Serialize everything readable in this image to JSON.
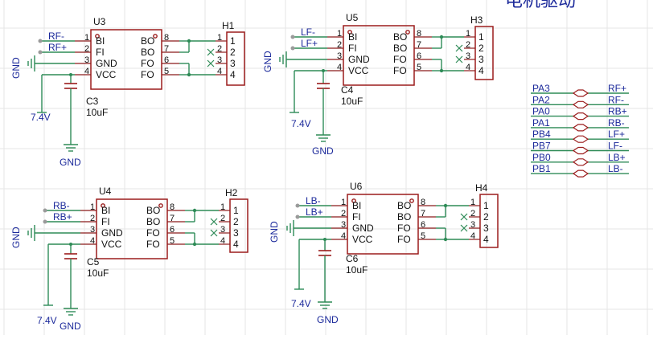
{
  "title": "电机驱动",
  "chips": [
    {
      "ref": "U3",
      "inputs": [
        "RF-",
        "RF+"
      ],
      "pins_left": [
        {
          "num": "1",
          "name": "BI"
        },
        {
          "num": "2",
          "name": "FI"
        },
        {
          "num": "3",
          "name": "GND"
        },
        {
          "num": "4",
          "name": "VCC"
        }
      ],
      "pins_right": [
        {
          "num": "8",
          "name": "BO"
        },
        {
          "num": "7",
          "name": "BO"
        },
        {
          "num": "6",
          "name": "FO"
        },
        {
          "num": "5",
          "name": "FO"
        }
      ],
      "cap_ref": "C3",
      "cap_value": "10uF",
      "supply": "7.4V",
      "ground": "GND",
      "header_ref": "H1",
      "header_pins": [
        "1",
        "2",
        "3",
        "4"
      ]
    },
    {
      "ref": "U5",
      "inputs": [
        "LF-",
        "LF+"
      ],
      "pins_left": [
        {
          "num": "1",
          "name": "BI"
        },
        {
          "num": "2",
          "name": "FI"
        },
        {
          "num": "3",
          "name": "GND"
        },
        {
          "num": "4",
          "name": "VCC"
        }
      ],
      "pins_right": [
        {
          "num": "8",
          "name": "BO"
        },
        {
          "num": "7",
          "name": "BO"
        },
        {
          "num": "6",
          "name": "FO"
        },
        {
          "num": "5",
          "name": "FO"
        }
      ],
      "cap_ref": "C4",
      "cap_value": "10uF",
      "supply": "7.4V",
      "ground": "GND",
      "header_ref": "H3",
      "header_pins": [
        "1",
        "2",
        "3",
        "4"
      ]
    },
    {
      "ref": "U4",
      "inputs": [
        "RB-",
        "RB+"
      ],
      "pins_left": [
        {
          "num": "1",
          "name": "BI"
        },
        {
          "num": "2",
          "name": "FI"
        },
        {
          "num": "3",
          "name": "GND"
        },
        {
          "num": "4",
          "name": "VCC"
        }
      ],
      "pins_right": [
        {
          "num": "8",
          "name": "BO"
        },
        {
          "num": "7",
          "name": "BO"
        },
        {
          "num": "6",
          "name": "FO"
        },
        {
          "num": "5",
          "name": "FO"
        }
      ],
      "cap_ref": "C5",
      "cap_value": "10uF",
      "supply": "7.4V",
      "ground": "GND",
      "header_ref": "H2",
      "header_pins": [
        "1",
        "2",
        "3",
        "4"
      ]
    },
    {
      "ref": "U6",
      "inputs": [
        "LB-",
        "LB+"
      ],
      "pins_left": [
        {
          "num": "1",
          "name": "BI"
        },
        {
          "num": "2",
          "name": "FI"
        },
        {
          "num": "3",
          "name": "GND"
        },
        {
          "num": "4",
          "name": "VCC"
        }
      ],
      "pins_right": [
        {
          "num": "8",
          "name": "BO"
        },
        {
          "num": "7",
          "name": "BO"
        },
        {
          "num": "6",
          "name": "FO"
        },
        {
          "num": "5",
          "name": "FO"
        }
      ],
      "cap_ref": "C6",
      "cap_value": "10uF",
      "supply": "7.4V",
      "ground": "GND",
      "header_ref": "H4",
      "header_pins": [
        "1",
        "2",
        "3",
        "4"
      ]
    }
  ],
  "net_map": [
    {
      "port": "PA3",
      "net": "RF+"
    },
    {
      "port": "PA2",
      "net": "RF-"
    },
    {
      "port": "PA0",
      "net": "RB+"
    },
    {
      "port": "PA1",
      "net": "RB-"
    },
    {
      "port": "PB4",
      "net": "LF+"
    },
    {
      "port": "PB7",
      "net": "LF-"
    },
    {
      "port": "PB0",
      "net": "LB+"
    },
    {
      "port": "PB1",
      "net": "LB-"
    }
  ]
}
